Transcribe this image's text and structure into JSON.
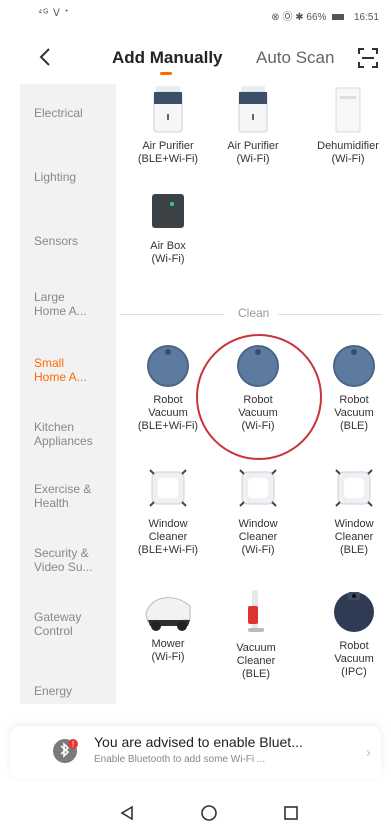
{
  "status_bar": {
    "left_text": "⁴ᴳ ᐯ ᐩ",
    "right_text": "⊗ Ⓞ ✱ 66%",
    "time": "16:51"
  },
  "header": {
    "tabs": [
      {
        "label": "Add Manually",
        "active": true
      },
      {
        "label": "Auto Scan",
        "active": false
      }
    ],
    "accent_color": "#ff6a00"
  },
  "sidebar": {
    "items": [
      {
        "label": "Electrical"
      },
      {
        "label": "Lighting"
      },
      {
        "label": "Sensors"
      },
      {
        "label": "Large Home A..."
      },
      {
        "label": "Small Home A...",
        "active": true
      },
      {
        "label": "Kitchen Appliances"
      },
      {
        "label": "Exercise & Health"
      },
      {
        "label": "Security & Video Su..."
      },
      {
        "label": "Gateway Control"
      },
      {
        "label": "Energy"
      }
    ]
  },
  "devices": [
    {
      "name": "Air Purifier\n(BLE+Wi-Fi)",
      "icon": "air-purifier-icon"
    },
    {
      "name": "Air Purifier\n(Wi-Fi)",
      "icon": "air-purifier-icon"
    },
    {
      "name": "Dehumidifier\n(Wi-Fi)",
      "icon": "dehumidifier-icon"
    },
    {
      "name": "Air Box\n(Wi-Fi)",
      "icon": "air-box-icon"
    },
    {
      "name": "Robot\nVacuum\n(BLE+Wi-Fi)",
      "icon": "robot-vacuum-icon"
    },
    {
      "name": "Robot\nVacuum\n(Wi-Fi)",
      "icon": "robot-vacuum-icon"
    },
    {
      "name": "Robot\nVacuum\n(BLE)",
      "icon": "robot-vacuum-icon"
    },
    {
      "name": "Window\nCleaner\n(BLE+Wi-Fi)",
      "icon": "window-cleaner-icon"
    },
    {
      "name": "Window\nCleaner\n(Wi-Fi)",
      "icon": "window-cleaner-icon"
    },
    {
      "name": "Window\nCleaner\n(BLE)",
      "icon": "window-cleaner-icon"
    },
    {
      "name": "Mower\n(Wi-Fi)",
      "icon": "mower-icon"
    },
    {
      "name": "Vacuum\nCleaner\n(BLE)",
      "icon": "vacuum-cleaner-icon"
    },
    {
      "name": "Robot\nVacuum\n(IPC)",
      "icon": "robot-vacuum-ipc-icon"
    }
  ],
  "section_label": "Clean",
  "highlight_color": "#c7343a",
  "bluetooth_prompt": {
    "title": "You are advised to enable Bluet...",
    "subtitle": "Enable Bluetooth to add some Wi-Fi ...",
    "badge": "!"
  }
}
